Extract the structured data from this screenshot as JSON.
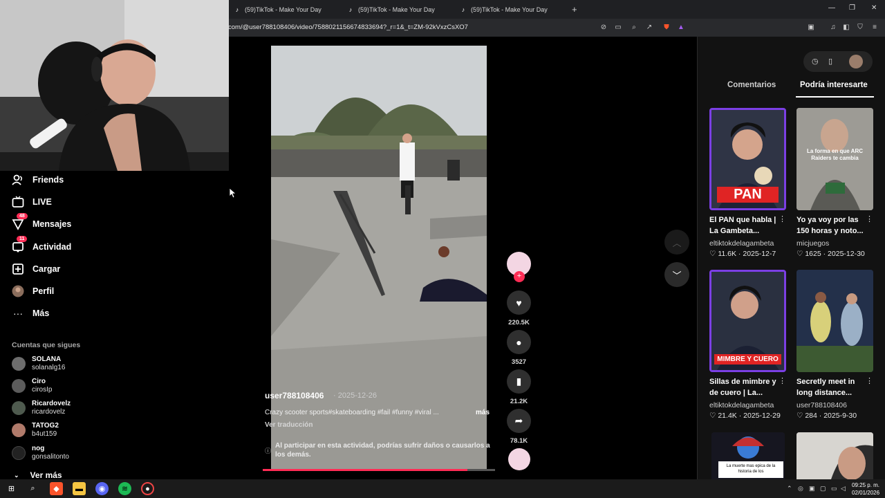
{
  "browser": {
    "tabs": [
      {
        "title": "(59)TikTok - Make Your Day"
      },
      {
        "title": "(59)TikTok - Make Your Day"
      },
      {
        "title": "(59)TikTok - Make Your Day"
      }
    ],
    "new_tab": "+",
    "url": "com/@user788108406/video/7588021156674833694?_r=1&_t=ZM-92kVxzCsXO7"
  },
  "sidebar": {
    "items": [
      {
        "label": "Friends",
        "icon": "friends-icon"
      },
      {
        "label": "LIVE",
        "icon": "live-icon"
      },
      {
        "label": "Mensajes",
        "icon": "messages-icon",
        "badge": "48"
      },
      {
        "label": "Actividad",
        "icon": "activity-icon",
        "badge": "11"
      },
      {
        "label": "Cargar",
        "icon": "upload-icon"
      },
      {
        "label": "Perfil",
        "icon": "profile-icon"
      },
      {
        "label": "Más",
        "icon": "more-icon"
      }
    ],
    "following_title": "Cuentas que sigues",
    "accounts": [
      {
        "name": "SOLANA",
        "handle": "solanalg16"
      },
      {
        "name": "Ciro",
        "handle": "cirosIp"
      },
      {
        "name": "Ricardovelz",
        "handle": "ricardovelz"
      },
      {
        "name": "TATOG2",
        "handle": "b4ut159"
      },
      {
        "name": "nog",
        "handle": "gonsalitonto"
      }
    ],
    "see_more": "Ver más"
  },
  "video": {
    "author": "user788108406",
    "date": "· 2025-12-26",
    "description": "Crazy scooter sports#skateboarding #fail #funny #viral ...",
    "more": "más",
    "translate": "Ver traducción",
    "warning": "Al participar en esta actividad, podrías sufrir daños o causarlos a los demás.",
    "progress": 0.88,
    "likes": "220.5K",
    "comments": "3527",
    "saves": "21.2K",
    "shares": "78.1K"
  },
  "right_panel": {
    "tabs": [
      "Comentarios",
      "Podría interesarte"
    ],
    "active_tab": 1,
    "cards": [
      {
        "title": "El PAN que habla | La Gambeta...",
        "author": "eltiktokdelagambeta",
        "likes": "11.6K",
        "date": "2025-12-7",
        "thumb_text": "PAN"
      },
      {
        "title": "Yo ya voy por las 150 horas y noto...",
        "author": "micjuegos",
        "likes": "1625",
        "date": "2025-12-30",
        "thumb_text": "La forma en que ARC Raiders te cambia"
      },
      {
        "title": "Sillas de mimbre y de cuero | La...",
        "author": "eltiktokdelagambeta",
        "likes": "21.4K",
        "date": "2025-12-29",
        "thumb_text": "MIMBRE Y CUERO"
      },
      {
        "title": "Secretly meet in long distance...",
        "author": "user788108406",
        "likes": "284",
        "date": "2025-9-30",
        "thumb_text": ""
      },
      {
        "title": "",
        "author": "",
        "likes": "",
        "date": "",
        "thumb_text": "La muerte mas epica de la historia de los"
      },
      {
        "title": "",
        "author": "",
        "likes": "",
        "date": "",
        "thumb_text": ""
      }
    ]
  },
  "taskbar": {
    "time": "09:25 p. m.",
    "date": "02/01/2026"
  },
  "colors": {
    "accent": "#fe2c55",
    "card_border": "#7b3fe4"
  }
}
